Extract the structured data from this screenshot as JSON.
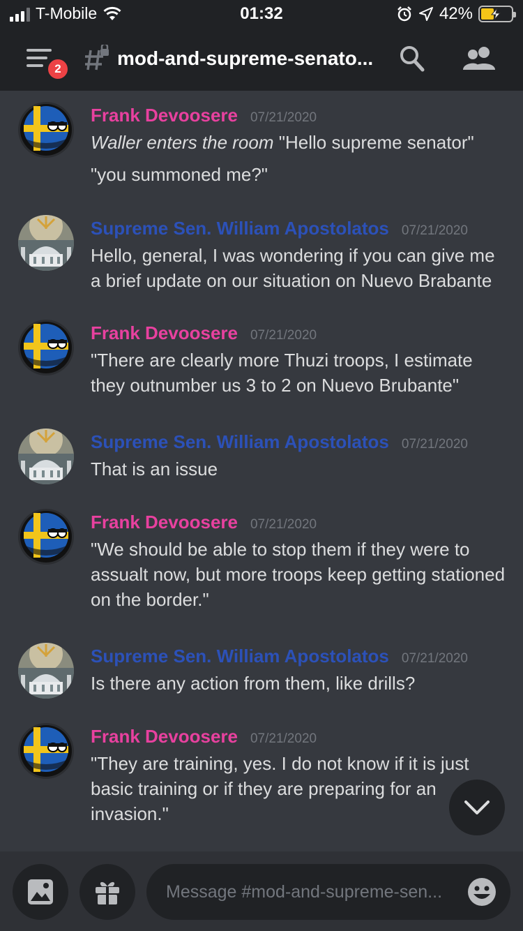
{
  "status_bar": {
    "carrier": "T-Mobile",
    "time": "01:32",
    "battery": "42%",
    "battery_level": 0.42
  },
  "header": {
    "unread_count": "2",
    "channel_title": "mod-and-supreme-senato..."
  },
  "messages": [
    {
      "author": "Frank Devoosere",
      "timestamp": "07/21/2020",
      "lines": [
        "Waller enters the room",
        "\"Hello supreme senator\"",
        "\"you summoned me?\""
      ]
    },
    {
      "author": "Supreme Sen. William Apostolatos",
      "timestamp": "07/21/2020",
      "text": "Hello, general, I was wondering if you can give me a brief update on our situation on Nuevo Brabante"
    },
    {
      "author": "Frank Devoosere",
      "timestamp": "07/21/2020",
      "text": "\"There are clearly more Thuzi troops, I estimate they outnumber us 3 to 2 on Nuevo Brubante\""
    },
    {
      "author": "Supreme Sen. William Apostolatos",
      "timestamp": "07/21/2020",
      "text": "That is an issue"
    },
    {
      "author": "Frank Devoosere",
      "timestamp": "07/21/2020",
      "text": "\"We should be able to stop them if they were to assualt now, but more troops keep getting stationed on the border.\""
    },
    {
      "author": "Supreme Sen. William Apostolatos",
      "timestamp": "07/21/2020",
      "text": "Is there any action from them, like drills?"
    },
    {
      "author": "Frank Devoosere",
      "timestamp": "07/21/2020",
      "text": "\"They are training, yes. I do not know if it is just basic training or if they are preparing for an invasion.\""
    }
  ],
  "composer": {
    "placeholder": "Message #mod-and-supreme-sen..."
  },
  "colors": {
    "frank": "#e8419f",
    "william": "#2c51b8",
    "background": "#36393f",
    "header": "#202225"
  }
}
